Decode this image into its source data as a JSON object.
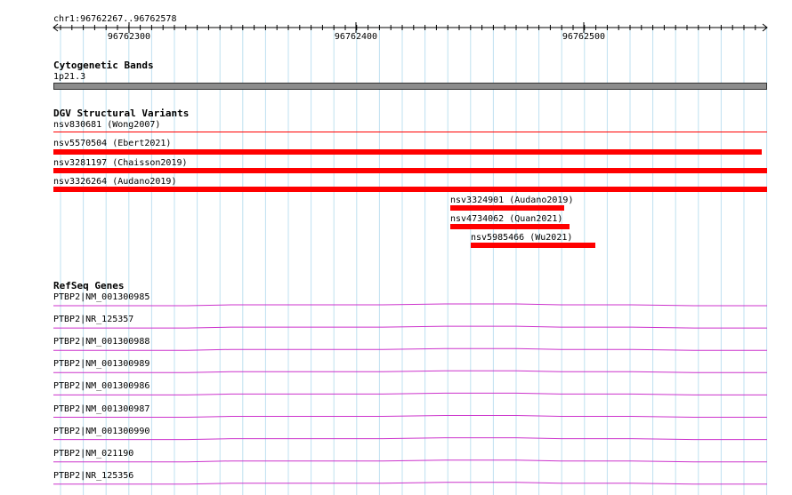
{
  "locus": "chr1:96762267..96762578",
  "ruler": {
    "ticks": [
      {
        "label": "96762300"
      },
      {
        "label": "96762400"
      },
      {
        "label": "96762500"
      }
    ]
  },
  "cytoband": {
    "title": "Cytogenetic Bands",
    "band": "1p21.3",
    "color": "#8c8c8c"
  },
  "dgv": {
    "title": "DGV Structural Variants",
    "color": "#ff0000",
    "variants": [
      {
        "label": "nsv830681 (Wong2007)"
      },
      {
        "label": "nsv5570504 (Ebert2021)"
      },
      {
        "label": "nsv3281197 (Chaisson2019)"
      },
      {
        "label": "nsv3326264 (Audano2019)"
      },
      {
        "label": "nsv3324901 (Audano2019)"
      },
      {
        "label": "nsv4734062 (Quan2021)"
      },
      {
        "label": "nsv5985466 (Wu2021)"
      }
    ]
  },
  "refseq": {
    "title": "RefSeq Genes",
    "color": "#cc33cc",
    "transcripts": [
      {
        "label": "PTBP2|NM_001300985"
      },
      {
        "label": "PTBP2|NR_125357"
      },
      {
        "label": "PTBP2|NM_001300988"
      },
      {
        "label": "PTBP2|NM_001300989"
      },
      {
        "label": "PTBP2|NM_001300986"
      },
      {
        "label": "PTBP2|NM_001300987"
      },
      {
        "label": "PTBP2|NM_001300990"
      },
      {
        "label": "PTBP2|NM_021190"
      },
      {
        "label": "PTBP2|NR_125356"
      }
    ]
  }
}
